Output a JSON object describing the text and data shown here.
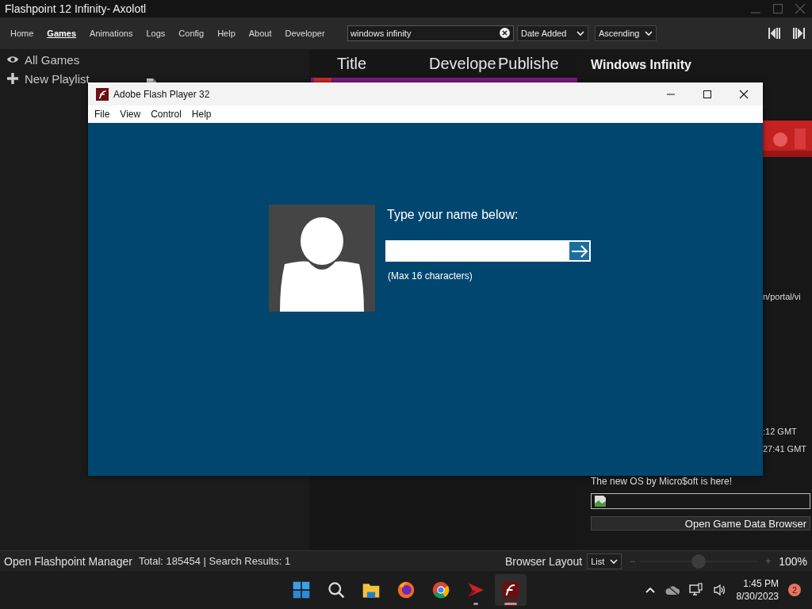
{
  "window": {
    "title": "Flashpoint 12 Infinity- Axolotl"
  },
  "nav": [
    {
      "label": "Home",
      "selected": false
    },
    {
      "label": "Games",
      "selected": true
    },
    {
      "label": "Animations",
      "selected": false
    },
    {
      "label": "Logs",
      "selected": false
    },
    {
      "label": "Config",
      "selected": false
    },
    {
      "label": "Help",
      "selected": false
    },
    {
      "label": "About",
      "selected": false
    },
    {
      "label": "Developer",
      "selected": false
    }
  ],
  "search": {
    "value": "windows infinity"
  },
  "sort_field": {
    "value": "Date Added"
  },
  "sort_order": {
    "value": "Ascending"
  },
  "sidebar": {
    "items": [
      {
        "kind": "eye",
        "label": "All Games"
      }
    ],
    "actions": [
      {
        "kind": "plus",
        "label": "New Playlist"
      },
      {
        "kind": "file"
      }
    ]
  },
  "game_list": {
    "columns": [
      "Title",
      "Develope",
      "Publishe"
    ]
  },
  "details": {
    "title": "Windows Infinity",
    "link_fragment": "n/portal/vi",
    "dates": [
      ":12 GMT",
      "27:41 GMT"
    ],
    "description": "The new OS by Micro$oft is here!",
    "button": "Open Game Data Browser"
  },
  "flash_window": {
    "title": "Adobe Flash Player 32",
    "menu": [
      "File",
      "View",
      "Control",
      "Help"
    ],
    "prompt": "Type your name below:",
    "hint": "(Max 16 characters)"
  },
  "status_bar": {
    "manager_button": "Open Flashpoint Manager",
    "totals": "Total: 185454 | Search Results: 1",
    "layout_label": "Browser Layout",
    "layout": "List",
    "zoom_minus": "−",
    "zoom": {
      "level": 0.5
    },
    "zoom_plus": "+",
    "zoom_reading": "100%"
  },
  "taskbar": {
    "apps": [
      {
        "kind": "start",
        "running": false,
        "active": false
      },
      {
        "kind": "search",
        "running": false,
        "active": false
      },
      {
        "kind": "folder",
        "running": false,
        "active": false
      },
      {
        "kind": "firefox",
        "running": false,
        "active": false
      },
      {
        "kind": "chrome",
        "running": false,
        "active": false
      },
      {
        "kind": "arrow",
        "running": true,
        "active": false
      },
      {
        "kind": "flash",
        "running": true,
        "active": true
      }
    ],
    "time": "1:45 PM",
    "date": "8/30/2023",
    "notifications": "2"
  }
}
